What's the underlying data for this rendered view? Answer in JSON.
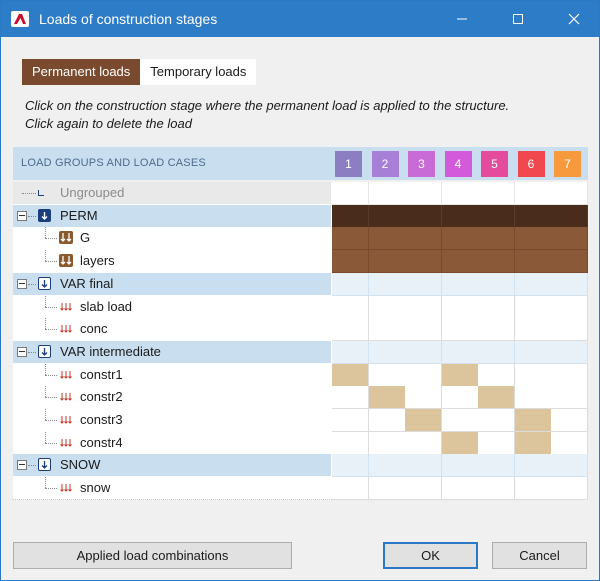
{
  "window": {
    "title": "Loads of construction stages"
  },
  "tabs": [
    {
      "label": "Permanent loads",
      "active": true
    },
    {
      "label": "Temporary loads",
      "active": false
    }
  ],
  "instructions": {
    "line1": "Click on the construction stage where the permanent load is applied to the structure.",
    "line2": "Click again to delete the load"
  },
  "grid": {
    "header_label": "LOAD GROUPS AND LOAD CASES",
    "stages": [
      {
        "label": "1",
        "color": "#8b7fc2"
      },
      {
        "label": "2",
        "color": "#a77fd6"
      },
      {
        "label": "3",
        "color": "#c96bd6"
      },
      {
        "label": "4",
        "color": "#d35bd9"
      },
      {
        "label": "5",
        "color": "#e54b9c"
      },
      {
        "label": "6",
        "color": "#f0484e"
      },
      {
        "label": "7",
        "color": "#f79a3e"
      }
    ],
    "rows": [
      {
        "type": "ungrouped",
        "label": "Ungrouped",
        "cells": [
          "u",
          "u",
          "u",
          "u",
          "u",
          "u",
          "u"
        ]
      },
      {
        "type": "group",
        "label": "PERM",
        "icon": "perm-group-icon",
        "cells": [
          "d",
          "d",
          "d",
          "d",
          "d",
          "d",
          "d"
        ]
      },
      {
        "type": "case",
        "label": "G",
        "icon": "permanent-load-icon",
        "cells": [
          "b",
          "b",
          "b",
          "b",
          "b",
          "b",
          "b"
        ]
      },
      {
        "type": "case",
        "label": "layers",
        "icon": "permanent-load-icon",
        "cells": [
          "b",
          "b",
          "b",
          "b",
          "b",
          "b",
          "b"
        ]
      },
      {
        "type": "group",
        "label": "VAR final",
        "icon": "variable-group-icon",
        "cells": [
          "g",
          "g",
          "g",
          "g",
          "g",
          "g",
          "g"
        ]
      },
      {
        "type": "case",
        "label": "slab load",
        "icon": "variable-load-icon",
        "cells": [
          "e",
          "e",
          "e",
          "e",
          "e",
          "e",
          "e"
        ]
      },
      {
        "type": "case",
        "label": "conc",
        "icon": "variable-load-icon",
        "cells": [
          "e",
          "e",
          "e",
          "e",
          "e",
          "e",
          "e"
        ]
      },
      {
        "type": "group",
        "label": "VAR intermediate",
        "icon": "variable-group-icon",
        "cells": [
          "g",
          "g",
          "g",
          "g",
          "g",
          "g",
          "g"
        ]
      },
      {
        "type": "case",
        "label": "constr1",
        "icon": "variable-load-icon",
        "cells": [
          "t",
          "e",
          "e",
          "t",
          "e",
          "e",
          "e"
        ]
      },
      {
        "type": "case",
        "label": "constr2",
        "icon": "variable-load-icon",
        "cells": [
          "e",
          "t",
          "e",
          "e",
          "t",
          "e",
          "e"
        ]
      },
      {
        "type": "case",
        "label": "constr3",
        "icon": "variable-load-icon",
        "cells": [
          "e",
          "e",
          "t",
          "e",
          "e",
          "t",
          "e"
        ]
      },
      {
        "type": "case",
        "label": "constr4",
        "icon": "variable-load-icon",
        "cells": [
          "e",
          "e",
          "e",
          "t",
          "e",
          "t",
          "e"
        ]
      },
      {
        "type": "group",
        "label": "SNOW",
        "icon": "variable-group-icon",
        "cells": [
          "g",
          "g",
          "g",
          "g",
          "g",
          "g",
          "g"
        ]
      },
      {
        "type": "case",
        "label": "snow",
        "icon": "variable-load-icon",
        "cells": [
          "e",
          "e",
          "e",
          "e",
          "e",
          "e",
          "e"
        ]
      }
    ]
  },
  "buttons": {
    "combinations": "Applied load combinations",
    "ok": "OK",
    "cancel": "Cancel"
  },
  "colors": {
    "title_bar": "#2d7cc8",
    "perm_group": "#4a2c1c",
    "perm_case": "#8a5a38",
    "applied_temp": "#dcc49c",
    "group_row": "#c9dff0"
  }
}
